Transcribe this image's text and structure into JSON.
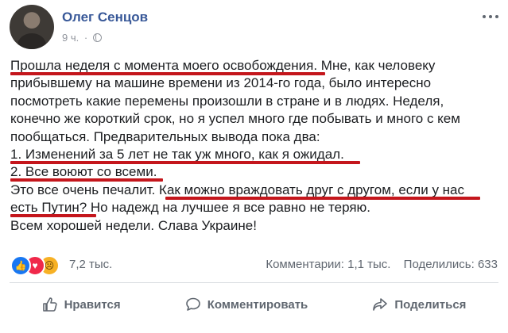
{
  "post": {
    "author": "Олег Сенцов",
    "time": "9 ч.",
    "separator": "·",
    "privacy_icon": "globe-icon",
    "lines": [
      "Прошла неделя с момента моего освобождения. Мне, как человеку",
      "прибывшему на машине времени из 2014-го года, было интересно",
      "посмотреть какие перемены произошли в стране и в людях. Неделя,",
      "конечно же короткий срок, но я успел много где побывать и много с кем",
      "пообщаться. Предварительных вывода пока два:",
      "1. Изменений за 5 лет не так уж много, как я ожидал.",
      "2. Все воюют со всеми.",
      "Это все очень печалит. Как можно враждовать друг с другом, если у нас",
      "есть Путин? Но надежд на лучшее я все равно не теряю.",
      "Всем хорошей недели. Слава Украине!"
    ],
    "highlight_color": "#c4161c"
  },
  "reactions": {
    "icons": [
      "like-icon",
      "love-icon",
      "sad-icon"
    ],
    "count": "7,2 тыс."
  },
  "stats": {
    "comments": "Комментарии: 1,1 тыс.",
    "shares": "Поделились: 633"
  },
  "actions": {
    "like_label": "Нравится",
    "comment_label": "Комментировать",
    "share_label": "Поделиться"
  },
  "colors": {
    "author": "#385898",
    "secondary_text": "#606770",
    "body_text": "#1c1e21"
  }
}
